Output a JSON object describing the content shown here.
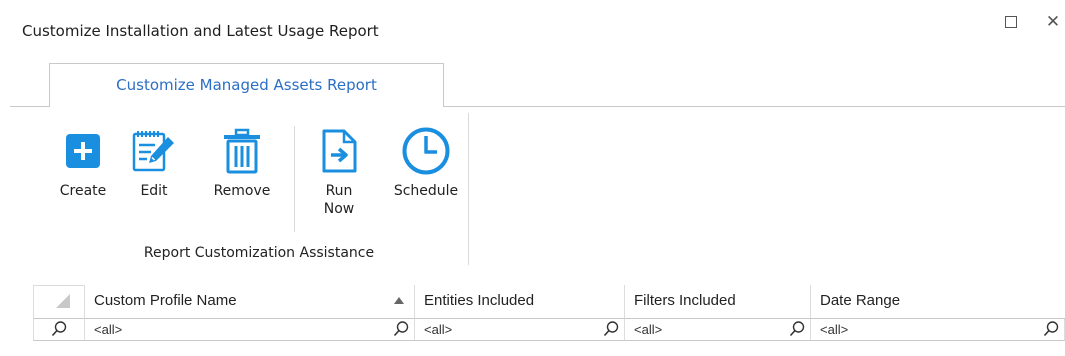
{
  "window": {
    "title": "Customize Installation and Latest Usage Report",
    "maximize_icon": "maximize-icon",
    "close_icon": "close-icon",
    "close_glyph": "✕"
  },
  "ribbon": {
    "tab_label": "Customize Managed Assets Report",
    "group_label": "Report Customization Assistance",
    "buttons": {
      "create": {
        "label": "Create",
        "icon": "plus-square-icon"
      },
      "edit": {
        "label": "Edit",
        "icon": "edit-document-icon"
      },
      "remove": {
        "label": "Remove",
        "icon": "trash-icon"
      },
      "run_now": {
        "label_line1": "Run",
        "label_line2": "Now",
        "icon": "run-document-icon"
      },
      "schedule": {
        "label": "Schedule",
        "icon": "clock-icon"
      }
    },
    "accent_color": "#1a8fe0",
    "tab_text_color": "#2b6fc4"
  },
  "grid": {
    "columns": [
      {
        "label": "Custom Profile Name",
        "sorted": "ascending"
      },
      {
        "label": "Entities Included"
      },
      {
        "label": "Filters Included"
      },
      {
        "label": "Date Range"
      }
    ],
    "filter_row": [
      "<all>",
      "<all>",
      "<all>",
      "<all>"
    ],
    "filter_icon": "search-icon"
  }
}
